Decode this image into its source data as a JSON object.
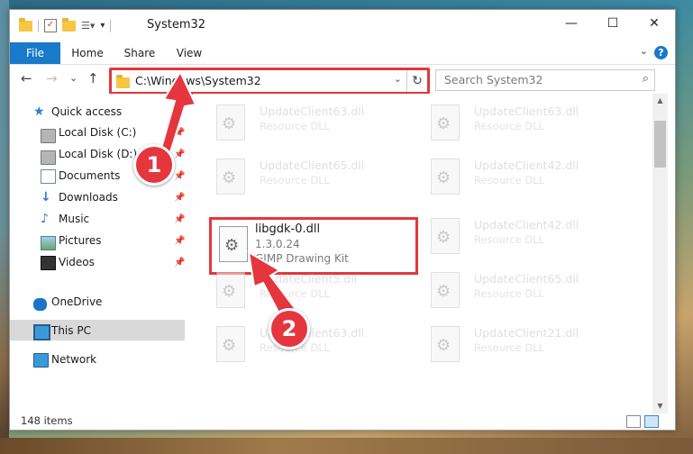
{
  "window": {
    "title": "System32",
    "minimize_label": "—",
    "maximize_label": "☐",
    "close_label": "✕"
  },
  "ribbon": {
    "tabs": [
      "File",
      "Home",
      "Share",
      "View"
    ]
  },
  "navigation": {
    "back": "←",
    "forward": "→",
    "recent": "⌄",
    "up": "↑",
    "address": "C:\\Windows\\System32",
    "search_placeholder": "Search System32"
  },
  "sidebar": {
    "items": [
      {
        "label": "Quick access",
        "icon": "star-icon"
      },
      {
        "label": "Local Disk (C:)",
        "icon": "disk-icon",
        "pinned": true
      },
      {
        "label": "Local Disk (D:)",
        "icon": "disk-icon",
        "pinned": true
      },
      {
        "label": "Documents",
        "icon": "documents-icon",
        "pinned": true
      },
      {
        "label": "Downloads",
        "icon": "download-icon",
        "pinned": true
      },
      {
        "label": "Music",
        "icon": "music-icon",
        "pinned": true
      },
      {
        "label": "Pictures",
        "icon": "pictures-icon",
        "pinned": true
      },
      {
        "label": "Videos",
        "icon": "videos-icon",
        "pinned": true
      },
      {
        "label": "OneDrive",
        "icon": "onedrive-icon"
      },
      {
        "label": "This PC",
        "icon": "pc-icon",
        "selected": true
      },
      {
        "label": "Network",
        "icon": "network-icon"
      }
    ]
  },
  "files": {
    "left_column": [
      {
        "name": "UpdateClient63.dll",
        "desc": "Resource DLL"
      },
      {
        "name": "UpdateClient65.dll",
        "desc": "Resource DLL"
      },
      {
        "name": "UpdateClient5.dll",
        "desc": "Resource DLL"
      },
      {
        "name": "UpdateClient63.dll",
        "desc": "Resource DLL"
      }
    ],
    "right_column": [
      {
        "name": "UpdateClient63.dll",
        "desc": "Resource DLL"
      },
      {
        "name": "UpdateClient42.dll",
        "desc": "Resource DLL"
      },
      {
        "name": "UpdateClient42.dll",
        "desc": "Resource DLL"
      },
      {
        "name": "UpdateClient65.dll",
        "desc": "Resource DLL"
      },
      {
        "name": "UpdateClient21.dll",
        "desc": "Resource DLL"
      }
    ],
    "highlighted": {
      "name": "libgdk-0.dll",
      "version": "1.3.0.24",
      "description": "GIMP Drawing Kit"
    }
  },
  "status": {
    "item_count": "148 items"
  },
  "callouts": {
    "first": "1",
    "second": "2"
  },
  "colors": {
    "highlight_red": "#e5363d",
    "accent_blue": "#1979ca"
  }
}
